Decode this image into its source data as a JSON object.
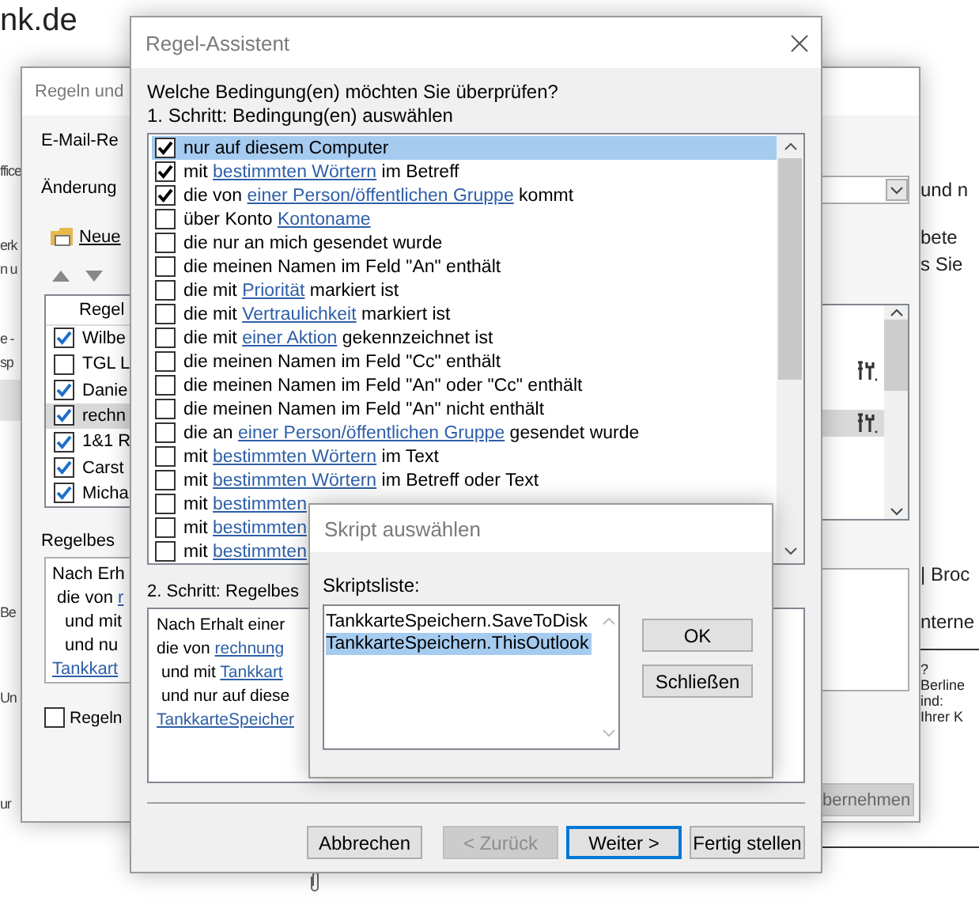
{
  "background_page": {
    "heading": "nk.de",
    "left_fragments": [
      "ffice",
      "erk",
      "n u",
      "e -",
      "sp",
      "Be",
      "Un",
      "ur"
    ],
    "right_fragments": [
      "und n",
      "bete",
      "s Sie",
      "| Broc",
      "nterne",
      "?",
      "Berline",
      "ind:",
      "Ihrer K"
    ]
  },
  "rules_window": {
    "title": "Regeln und",
    "tab": "E-Mail-Re",
    "changes_label": "Änderung",
    "new_button": "Neue",
    "list_header": "Regel",
    "rules": [
      {
        "name": "Wilbe",
        "enabled": true,
        "selected": false,
        "script_icon": false
      },
      {
        "name": "TGL L",
        "enabled": false,
        "selected": false,
        "script_icon": true
      },
      {
        "name": "Danie",
        "enabled": true,
        "selected": false,
        "script_icon": false
      },
      {
        "name": "rechn",
        "enabled": true,
        "selected": true,
        "script_icon": true
      },
      {
        "name": "1&1 R",
        "enabled": true,
        "selected": false,
        "script_icon": false
      },
      {
        "name": "Carst",
        "enabled": true,
        "selected": false,
        "script_icon": false
      },
      {
        "name": "Micha",
        "enabled": true,
        "selected": false,
        "script_icon": false
      }
    ],
    "description_label": "Regelbes",
    "description": [
      {
        "kind": "line",
        "parts": [
          {
            "text": "Nach Erh"
          }
        ]
      },
      {
        "kind": "sub",
        "parts": [
          {
            "text": "die von "
          },
          {
            "text": "r",
            "link": true
          }
        ]
      },
      {
        "kind": "subsub",
        "parts": [
          {
            "text": "und mit"
          }
        ]
      },
      {
        "kind": "subsub",
        "parts": [
          {
            "text": "und nu"
          }
        ]
      },
      {
        "kind": "line",
        "parts": [
          {
            "text": "Tankkart",
            "link": true
          }
        ]
      }
    ],
    "run_checkbox": {
      "label": "Regeln",
      "checked": false
    },
    "apply_button": {
      "label": "bernehmen",
      "disabled": true
    }
  },
  "wizard": {
    "title": "Regel-Assistent",
    "question": "Welche Bedingung(en) möchten Sie überprüfen?",
    "step1": "1. Schritt: Bedingung(en) auswählen",
    "conditions": [
      {
        "checked": true,
        "selected": true,
        "parts": [
          {
            "text": "nur auf diesem Computer"
          }
        ]
      },
      {
        "checked": true,
        "selected": false,
        "parts": [
          {
            "text": "mit "
          },
          {
            "text": "bestimmten Wörtern",
            "link": true
          },
          {
            "text": " im Betreff"
          }
        ]
      },
      {
        "checked": true,
        "selected": false,
        "parts": [
          {
            "text": "die von "
          },
          {
            "text": "einer Person/öffentlichen Gruppe",
            "link": true
          },
          {
            "text": " kommt"
          }
        ]
      },
      {
        "checked": false,
        "selected": false,
        "parts": [
          {
            "text": "über Konto "
          },
          {
            "text": "Kontoname",
            "link": true
          }
        ]
      },
      {
        "checked": false,
        "selected": false,
        "parts": [
          {
            "text": "die nur an mich gesendet wurde"
          }
        ]
      },
      {
        "checked": false,
        "selected": false,
        "parts": [
          {
            "text": "die meinen Namen im Feld \"An\" enthält"
          }
        ]
      },
      {
        "checked": false,
        "selected": false,
        "parts": [
          {
            "text": "die mit "
          },
          {
            "text": "Priorität",
            "link": true
          },
          {
            "text": " markiert ist"
          }
        ]
      },
      {
        "checked": false,
        "selected": false,
        "parts": [
          {
            "text": "die mit "
          },
          {
            "text": "Vertraulichkeit",
            "link": true
          },
          {
            "text": " markiert ist"
          }
        ]
      },
      {
        "checked": false,
        "selected": false,
        "parts": [
          {
            "text": "die mit "
          },
          {
            "text": "einer Aktion",
            "link": true
          },
          {
            "text": " gekennzeichnet ist"
          }
        ]
      },
      {
        "checked": false,
        "selected": false,
        "parts": [
          {
            "text": "die meinen Namen im Feld \"Cc\" enthält"
          }
        ]
      },
      {
        "checked": false,
        "selected": false,
        "parts": [
          {
            "text": "die meinen Namen im Feld \"An\" oder \"Cc\" enthält"
          }
        ]
      },
      {
        "checked": false,
        "selected": false,
        "parts": [
          {
            "text": "die meinen Namen im Feld \"An\" nicht enthält"
          }
        ]
      },
      {
        "checked": false,
        "selected": false,
        "parts": [
          {
            "text": "die an "
          },
          {
            "text": "einer Person/öffentlichen Gruppe",
            "link": true
          },
          {
            "text": " gesendet wurde"
          }
        ]
      },
      {
        "checked": false,
        "selected": false,
        "parts": [
          {
            "text": "mit "
          },
          {
            "text": "bestimmten Wörtern",
            "link": true
          },
          {
            "text": " im Text"
          }
        ]
      },
      {
        "checked": false,
        "selected": false,
        "parts": [
          {
            "text": "mit "
          },
          {
            "text": "bestimmten Wörtern",
            "link": true
          },
          {
            "text": " im Betreff oder Text"
          }
        ]
      },
      {
        "checked": false,
        "selected": false,
        "parts": [
          {
            "text": "mit "
          },
          {
            "text": "bestimmten",
            "link": true
          }
        ]
      },
      {
        "checked": false,
        "selected": false,
        "parts": [
          {
            "text": "mit "
          },
          {
            "text": "bestimmten",
            "link": true
          }
        ]
      },
      {
        "checked": false,
        "selected": false,
        "parts": [
          {
            "text": "mit "
          },
          {
            "text": "bestimmten",
            "link": true
          }
        ]
      }
    ],
    "step2": "2. Schritt: Regelbes",
    "description": [
      {
        "kind": "line",
        "parts": [
          {
            "text": "Nach Erhalt einer"
          }
        ]
      },
      {
        "kind": "line",
        "parts": [
          {
            "text": "die von "
          },
          {
            "text": "rechnung",
            "link": true
          }
        ]
      },
      {
        "kind": "sub",
        "parts": [
          {
            "text": "und mit "
          },
          {
            "text": "Tankkart",
            "link": true
          }
        ]
      },
      {
        "kind": "sub",
        "parts": [
          {
            "text": "und nur auf diese"
          }
        ]
      },
      {
        "kind": "line",
        "parts": [
          {
            "text": "TankkarteSpeicher",
            "link": true
          }
        ]
      }
    ],
    "buttons": [
      {
        "label": "Abbrechen",
        "disabled": false,
        "default": false
      },
      {
        "label": "< Zurück",
        "disabled": true,
        "default": false
      },
      {
        "label": "Weiter >",
        "disabled": false,
        "default": true
      },
      {
        "label": "Fertig stellen",
        "disabled": false,
        "default": false
      }
    ]
  },
  "script_dialog": {
    "title": "Skript auswählen",
    "list_label": "Skriptsliste:",
    "scripts": [
      {
        "name": "TankkarteSpeichern.SaveToDisk",
        "selected": false
      },
      {
        "name": "TankkarteSpeichern.ThisOutlook",
        "selected": true
      }
    ],
    "buttons": [
      "OK",
      "Schließen"
    ]
  }
}
